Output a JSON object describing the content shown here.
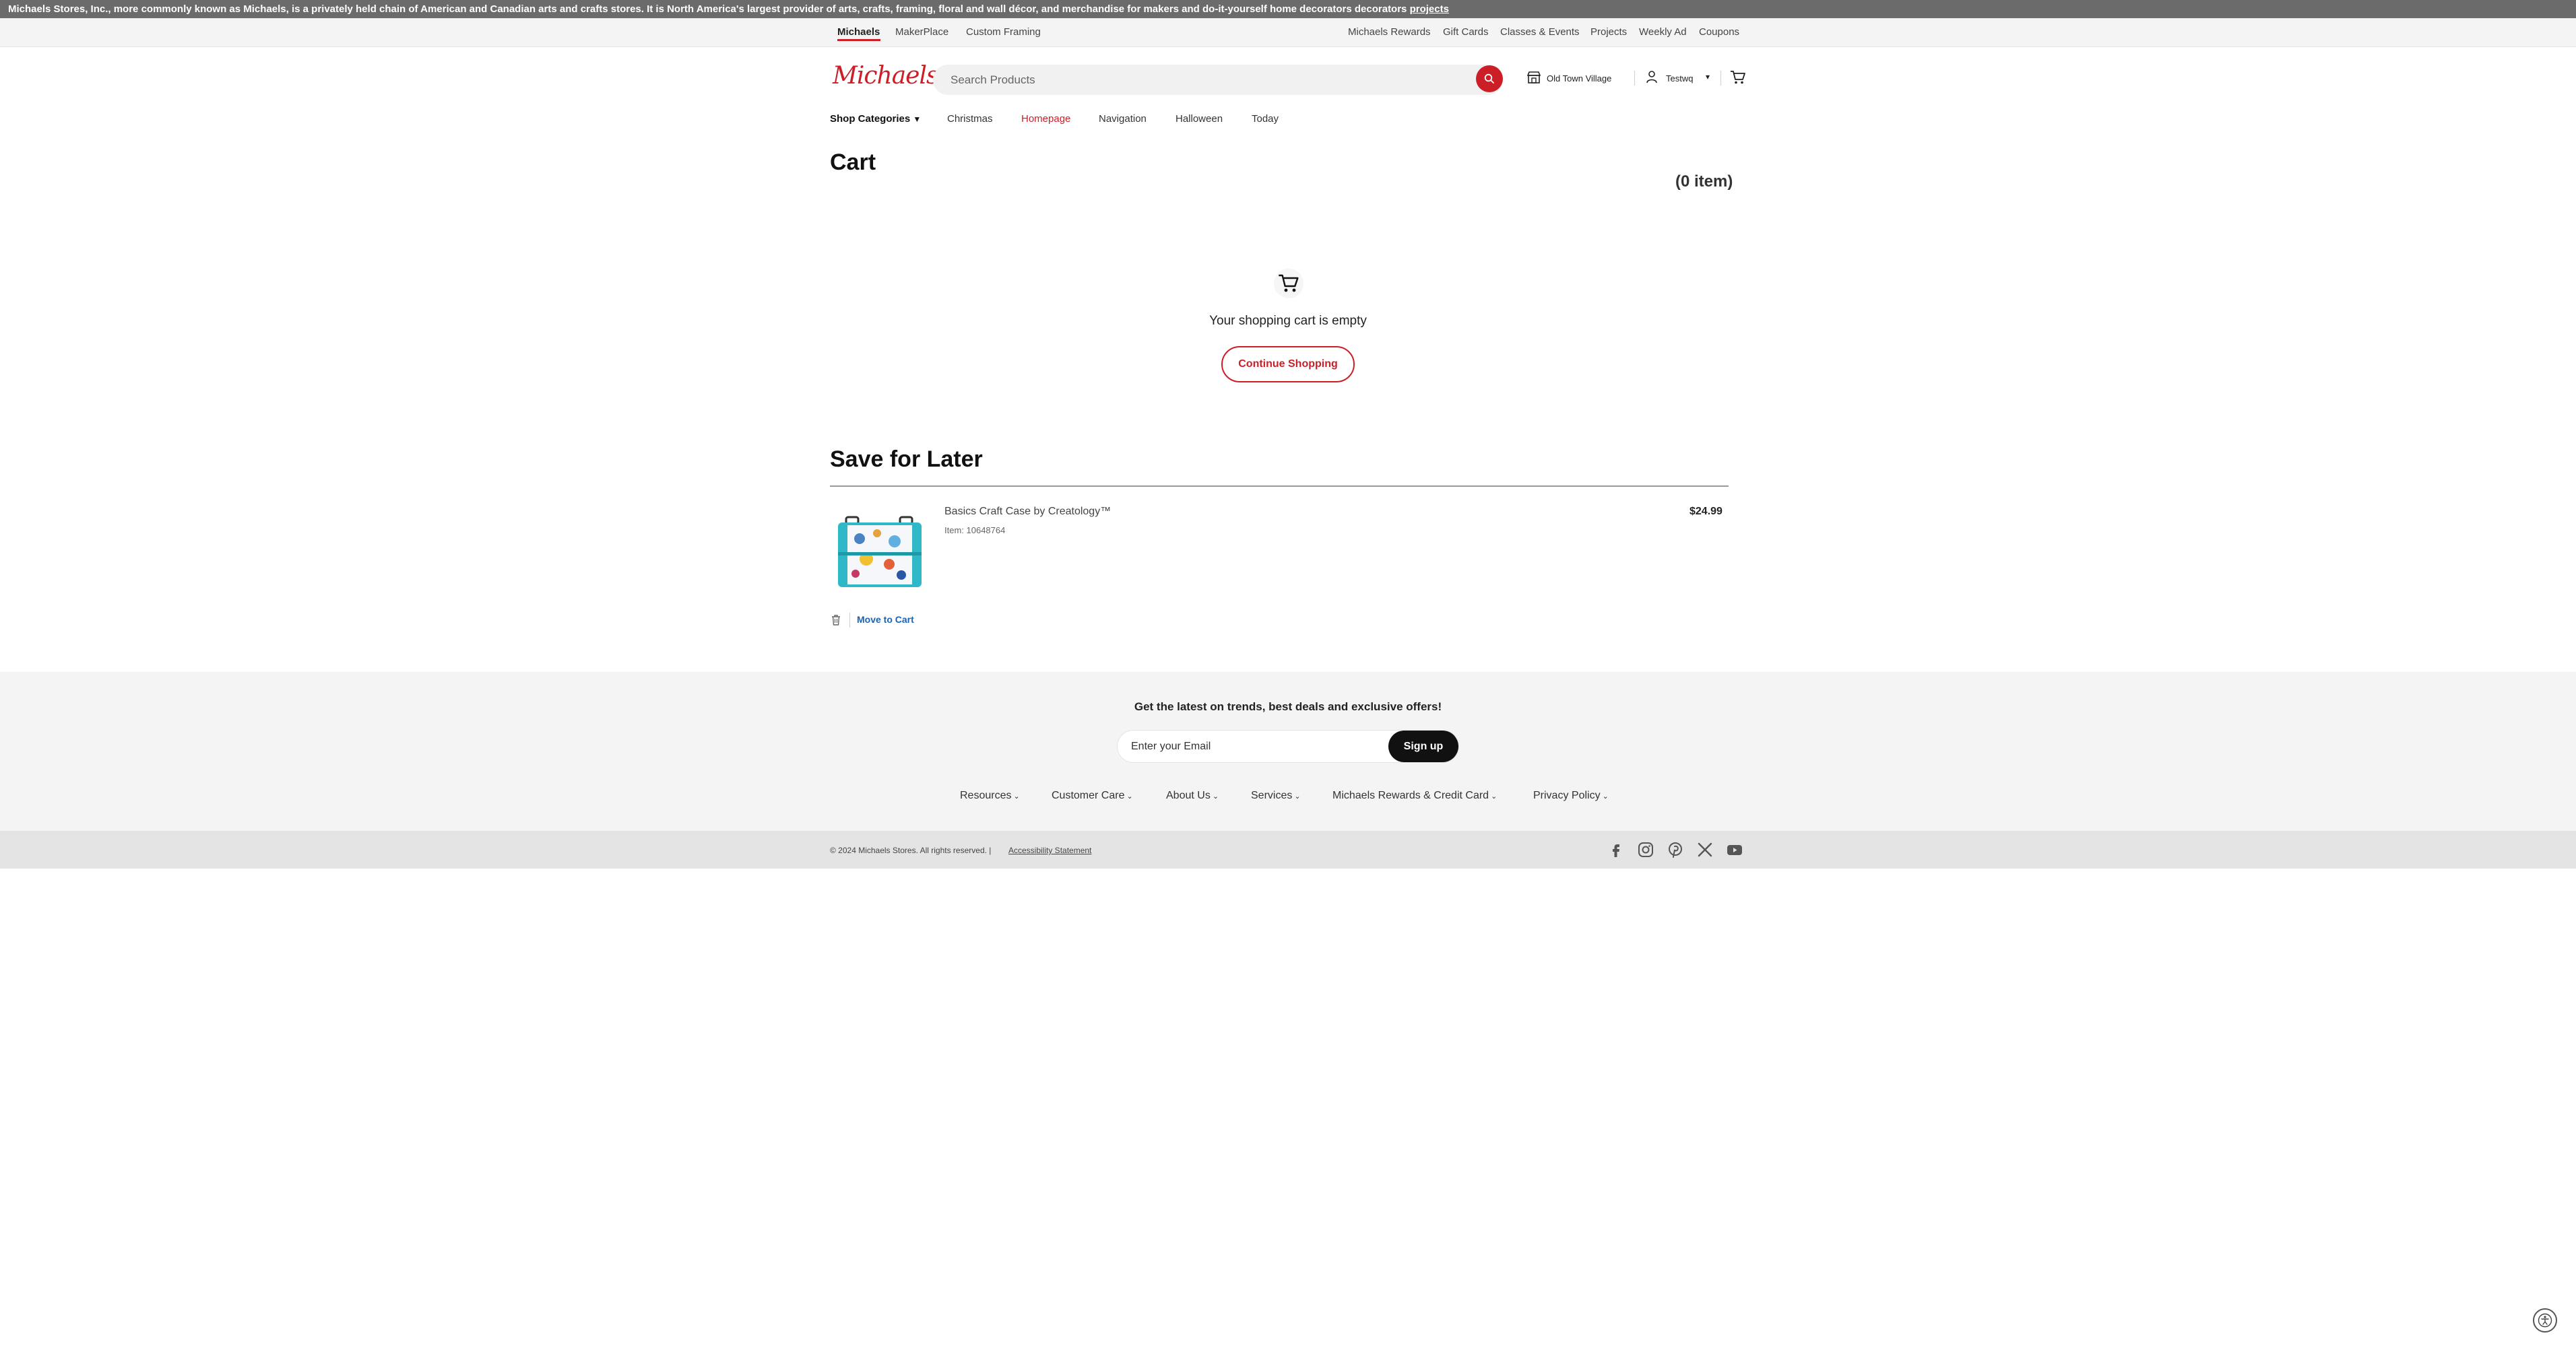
{
  "banner": {
    "text": "Michaels Stores, Inc., more commonly known as Michaels, is a privately held chain of American and Canadian arts and crafts stores. It is North America's largest provider of arts, crafts, framing, floral and wall décor, and merchandise for makers and do-it-yourself home decorators decorators",
    "link": "projects"
  },
  "utility": {
    "left": [
      "Michaels",
      "MakerPlace",
      "Custom Framing"
    ],
    "right": [
      "Michaels Rewards",
      "Gift Cards",
      "Classes & Events",
      "Projects",
      "Weekly Ad",
      "Coupons"
    ]
  },
  "header": {
    "logo": "Michaels",
    "search_placeholder": "Search Products",
    "store": "Old Town Village",
    "user": "Testwq",
    "caret": "▾"
  },
  "nav": {
    "shop_categories": "Shop Categories",
    "items": [
      "Christmas",
      "Homepage",
      "Navigation",
      "Halloween",
      "Today"
    ]
  },
  "cart": {
    "title": "Cart",
    "count": "(0 item)",
    "empty_text": "Your shopping cart is empty",
    "continue": "Continue Shopping"
  },
  "save_for_later": {
    "title": "Save for Later",
    "product": {
      "name": "Basics Craft Case by Creatology™",
      "item": "Item: 10648764",
      "price": "$24.99",
      "move_to_cart": "Move to Cart"
    }
  },
  "footer": {
    "newsletter": "Get the latest on trends, best deals and exclusive offers!",
    "email_placeholder": "Enter your Email",
    "signup": "Sign up",
    "links": [
      "Resources",
      "Customer Care",
      "About Us",
      "Services",
      "Michaels Rewards & Credit Card",
      "Privacy Policy"
    ],
    "copyright": "© 2024 Michaels Stores. All rights reserved.  |",
    "accessibility": "Accessibility Statement",
    "social": [
      "facebook-icon",
      "instagram-icon",
      "pinterest-icon",
      "x-icon",
      "youtube-icon"
    ]
  },
  "colors": {
    "brand_red": "#cc1e27",
    "link_blue": "#1a62b3",
    "banner_gray": "#6b6b6b"
  }
}
